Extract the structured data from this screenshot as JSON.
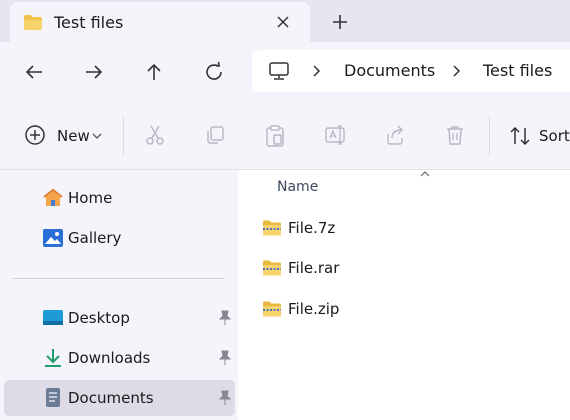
{
  "tab": {
    "title": "Test files",
    "icon": "folder-icon"
  },
  "nav": {
    "breadcrumb": [
      "Documents",
      "Test files"
    ]
  },
  "toolbar": {
    "new_label": "New",
    "sort_label": "Sort",
    "items": [
      "cut-icon",
      "copy-icon",
      "paste-icon",
      "rename-icon",
      "share-icon",
      "delete-icon"
    ]
  },
  "sidebar": {
    "items": [
      {
        "label": "Home",
        "icon": "home-icon",
        "pinned": false,
        "selected": false
      },
      {
        "label": "Gallery",
        "icon": "gallery-icon",
        "pinned": false,
        "selected": false
      },
      {
        "label": "Desktop",
        "icon": "desktop-icon",
        "pinned": true,
        "selected": false
      },
      {
        "label": "Downloads",
        "icon": "download-icon",
        "pinned": true,
        "selected": false
      },
      {
        "label": "Documents",
        "icon": "documents-icon",
        "pinned": true,
        "selected": true
      }
    ]
  },
  "list": {
    "column_name": "Name",
    "files": [
      {
        "name": "File.7z",
        "icon": "zip-folder-icon"
      },
      {
        "name": "File.rar",
        "icon": "zip-folder-icon"
      },
      {
        "name": "File.zip",
        "icon": "zip-folder-icon"
      }
    ]
  },
  "colors": {
    "chrome": "#f6f4fb",
    "tabstrip": "#e8e4f2",
    "selected": "#dedbe6",
    "folder": "#f2c14e"
  }
}
